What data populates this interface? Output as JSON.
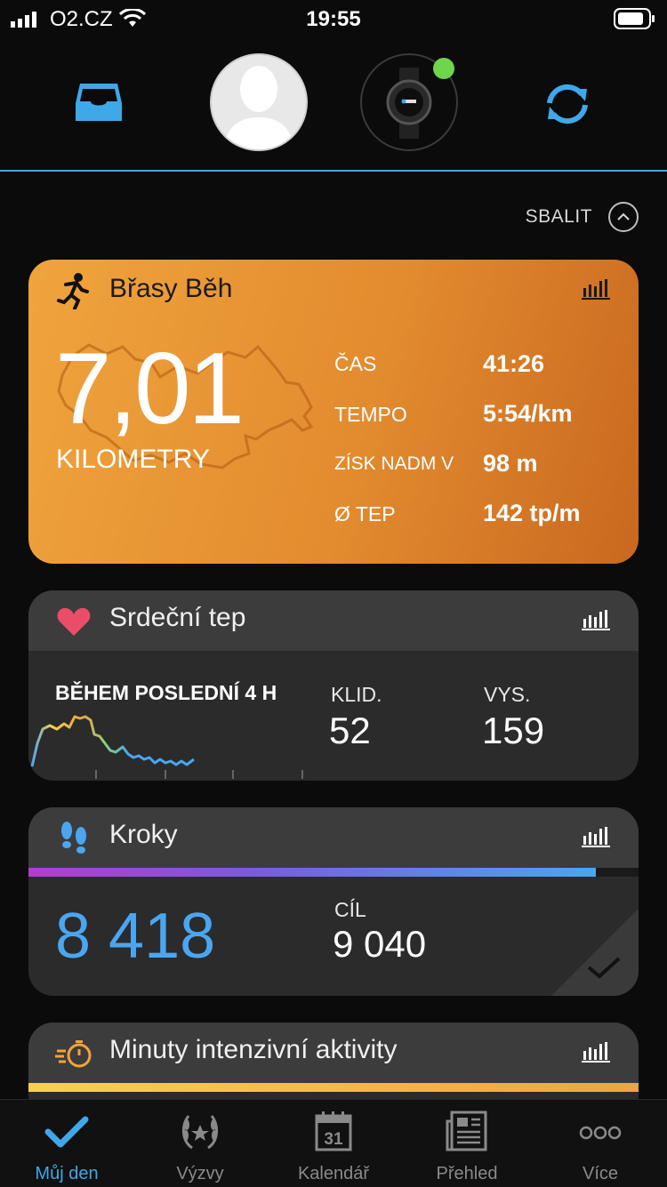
{
  "status_bar": {
    "carrier": "O2.CZ",
    "time": "19:55"
  },
  "header": {
    "inbox_icon": "inbox-icon",
    "avatar": "avatar-placeholder",
    "device": "watch-device",
    "sync_icon": "sync-icon"
  },
  "collapse": {
    "label": "SBALIT"
  },
  "run_card": {
    "title": "Břasy Běh",
    "distance": "7,01",
    "unit": "KILOMETRY",
    "stats": [
      {
        "label": "ČAS",
        "value": "41:26"
      },
      {
        "label": "TEMPO",
        "value": "5:54/km"
      },
      {
        "label": "ZÍSK NADM V",
        "value": "98 m"
      },
      {
        "label": "Ø TEP",
        "value": "142 tp/m"
      }
    ]
  },
  "heart_card": {
    "title": "Srdeční tep",
    "period": "BĚHEM POSLEDNÍ 4 H",
    "resting_label": "KLID.",
    "resting_value": "52",
    "high_label": "VYS.",
    "high_value": "159"
  },
  "steps_card": {
    "title": "Kroky",
    "value": "8 418",
    "goal_label": "CÍL",
    "goal_value": "9 040",
    "progress": 0.93
  },
  "intensity_card": {
    "title": "Minuty intenzivní aktivity"
  },
  "tabs": [
    {
      "label": "Můj den",
      "icon": "check-icon",
      "active": true
    },
    {
      "label": "Výzvy",
      "icon": "laurel-icon",
      "active": false
    },
    {
      "label": "Kalendář",
      "icon": "calendar-icon",
      "day": "31",
      "active": false
    },
    {
      "label": "Přehled",
      "icon": "news-icon",
      "active": false
    },
    {
      "label": "Více",
      "icon": "more-icon",
      "active": false
    }
  ],
  "colors": {
    "accent": "#3fa8e8",
    "run_orange": "#e28b2f",
    "steps_blue": "#4aa6f0",
    "online_green": "#6dd64a"
  }
}
